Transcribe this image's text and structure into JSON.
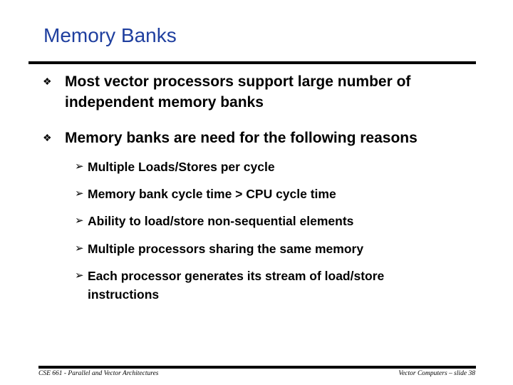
{
  "slide": {
    "title": "Memory Banks",
    "title_color": "#1f3f9f",
    "bullets": [
      {
        "icon": "diamond-bullet-icon",
        "glyph": "❖",
        "text": "Most vector processors support large number of independent memory banks"
      },
      {
        "icon": "diamond-bullet-icon",
        "glyph": "❖",
        "text": "Memory banks are need for the following reasons"
      }
    ],
    "sub_bullets": [
      {
        "icon": "arrow-bullet-icon",
        "glyph": "➢",
        "text": "Multiple Loads/Stores per cycle"
      },
      {
        "icon": "arrow-bullet-icon",
        "glyph": "➢",
        "text": "Memory bank cycle time > CPU cycle time"
      },
      {
        "icon": "arrow-bullet-icon",
        "glyph": "➢",
        "text": "Ability to load/store non-sequential elements"
      },
      {
        "icon": "arrow-bullet-icon",
        "glyph": "➢",
        "text": "Multiple processors sharing the same memory"
      },
      {
        "icon": "arrow-bullet-icon",
        "glyph": "➢",
        "text": "Each processor generates its stream of load/store instructions"
      }
    ]
  },
  "footer": {
    "left": "CSE 661 - Parallel and Vector Architectures",
    "right": "Vector Computers – slide 38"
  }
}
